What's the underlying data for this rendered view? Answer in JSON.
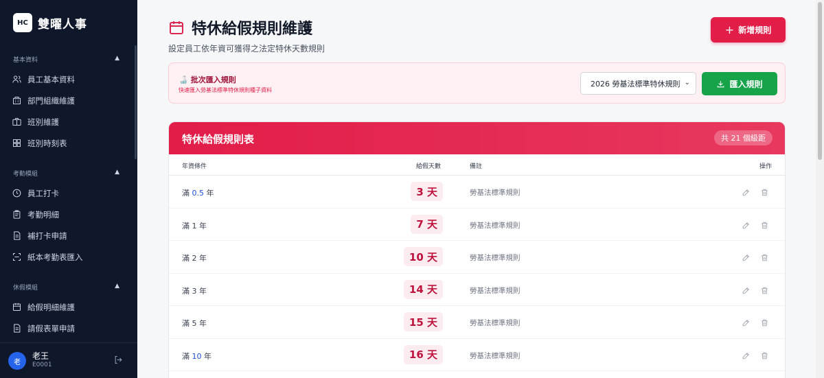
{
  "brand": {
    "logo": "HC",
    "name": "雙曜人事"
  },
  "sidebar": {
    "sections": [
      {
        "title": "基本資料",
        "items": [
          {
            "label": "員工基本資料",
            "icon": "users-icon"
          },
          {
            "label": "部門組織維護",
            "icon": "building-icon"
          },
          {
            "label": "班別維護",
            "icon": "briefcase-icon"
          },
          {
            "label": "班別時刻表",
            "icon": "grid-icon"
          }
        ]
      },
      {
        "title": "考勤模組",
        "items": [
          {
            "label": "員工打卡",
            "icon": "clock-icon"
          },
          {
            "label": "考勤明細",
            "icon": "clipboard-icon"
          },
          {
            "label": "補打卡申請",
            "icon": "document-icon"
          },
          {
            "label": "紙本考勤表匯入",
            "icon": "scan-icon"
          }
        ]
      },
      {
        "title": "休假模組",
        "items": [
          {
            "label": "給假明細維護",
            "icon": "calendar-icon"
          },
          {
            "label": "請假表單申請",
            "icon": "document-icon"
          }
        ]
      }
    ],
    "caret": "▲"
  },
  "user": {
    "avatar": "老",
    "name": "老王",
    "id": "E0001"
  },
  "header": {
    "title": "特休給假規則維護",
    "subtitle": "設定員工依年資可獲得之法定特休天數規則",
    "add_button": "新增規則",
    "add_plus": "+"
  },
  "import": {
    "icon": "🍶",
    "title": "批次匯入規則",
    "desc": "快速匯入勞基法標準特休規則種子資料",
    "select_value": "2026 勞基法標準特休規則",
    "select_chevron": "⌄",
    "button": "匯入規則"
  },
  "table": {
    "title": "特休給假規則表",
    "count": "共 21 個級距",
    "columns": {
      "condition": "年資條件",
      "days": "給假天數",
      "note": "備註",
      "action": "操作"
    },
    "rows": [
      {
        "prefix": "滿",
        "num": "0.5",
        "unit": "年",
        "days": "3 天",
        "note": "勞基法標準規則",
        "num_colored": true
      },
      {
        "prefix": "滿",
        "num": "1",
        "unit": "年",
        "days": "7 天",
        "note": "勞基法標準規則",
        "num_colored": false
      },
      {
        "prefix": "滿",
        "num": "2",
        "unit": "年",
        "days": "10 天",
        "note": "勞基法標準規則",
        "num_colored": false
      },
      {
        "prefix": "滿",
        "num": "3",
        "unit": "年",
        "days": "14 天",
        "note": "勞基法標準規則",
        "num_colored": false
      },
      {
        "prefix": "滿",
        "num": "5",
        "unit": "年",
        "days": "15 天",
        "note": "勞基法標準規則",
        "num_colored": false
      },
      {
        "prefix": "滿",
        "num": "10",
        "unit": "年",
        "days": "16 天",
        "note": "勞基法標準規則",
        "num_colored": true
      }
    ]
  },
  "colors": {
    "accent": "#e11d48",
    "success": "#16a34a",
    "sidebar": "#0f172a"
  }
}
